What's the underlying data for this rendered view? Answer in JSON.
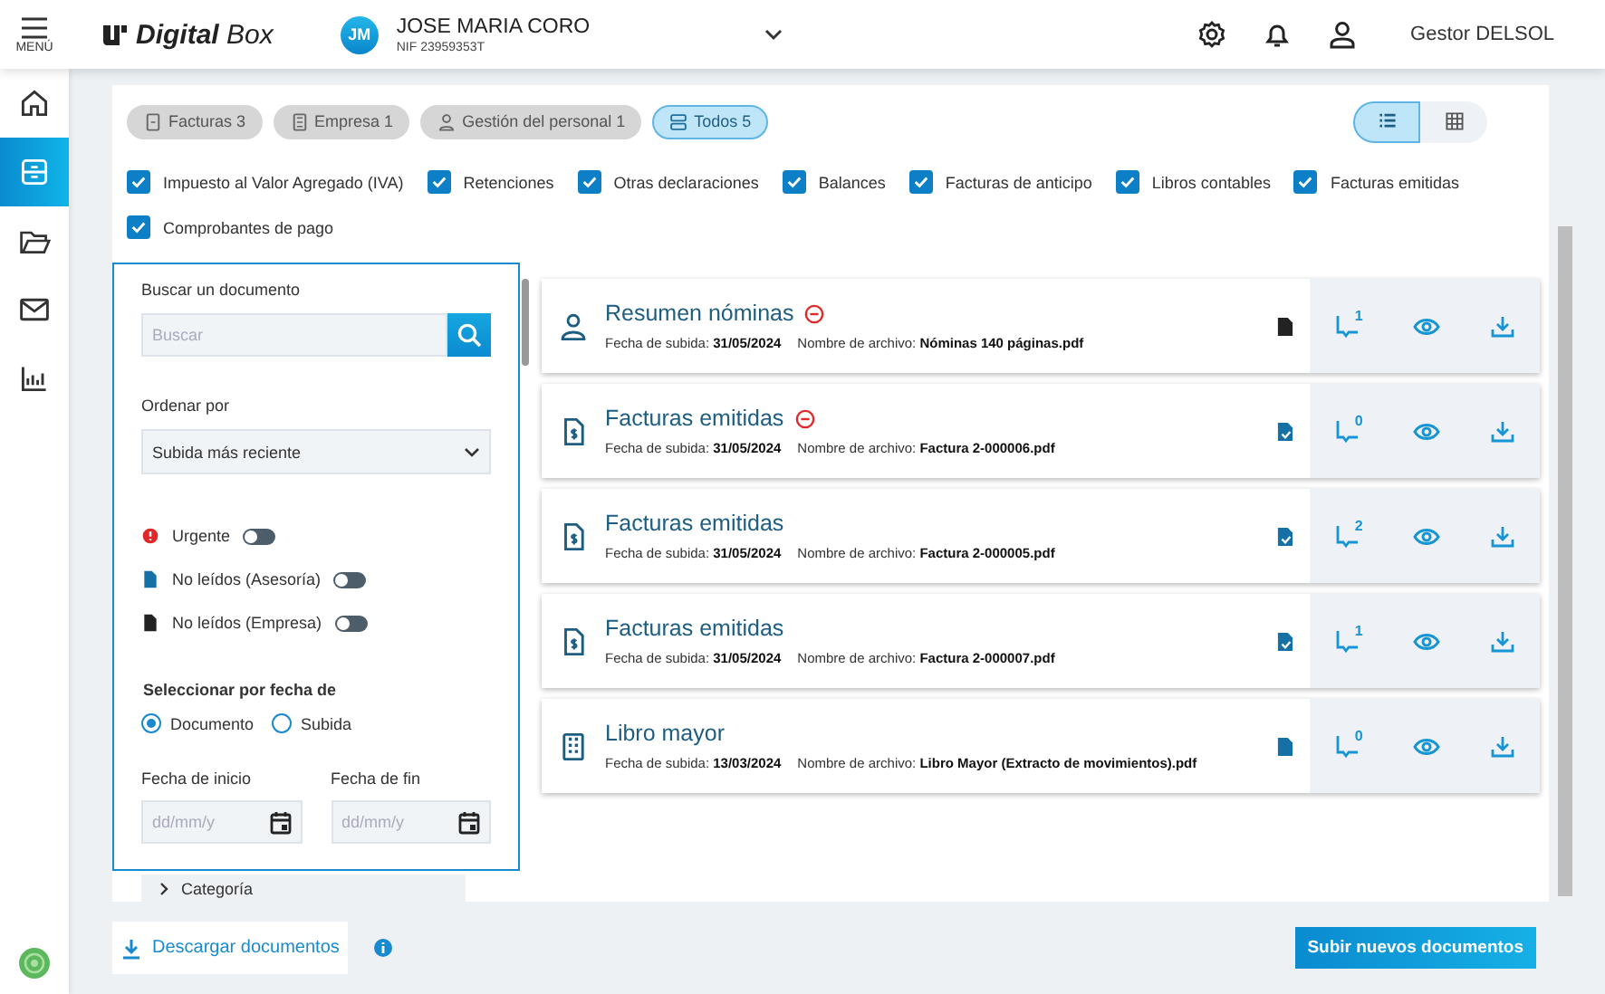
{
  "header": {
    "menu_label": "MENÚ",
    "logo": "**Digital** Box",
    "user": {
      "initials": "JM",
      "name": "JOSE MARIA CORO",
      "nif": "NIF 23959353T"
    },
    "account": "Gestor DELSOL"
  },
  "nav": [
    {
      "kind": "home",
      "selected": false
    },
    {
      "kind": "archive",
      "selected": true
    },
    {
      "kind": "folder",
      "selected": false
    },
    {
      "kind": "mail",
      "selected": false
    },
    {
      "kind": "chart",
      "selected": false
    }
  ],
  "chips": [
    {
      "kind": "invoice",
      "label": "Facturas 3",
      "selected": false
    },
    {
      "kind": "company",
      "label": "Empresa 1",
      "selected": false
    },
    {
      "kind": "person",
      "label": "Gestión del personal 1",
      "selected": false
    },
    {
      "kind": "all",
      "label": "Todos 5",
      "selected": true
    }
  ],
  "view_modes": [
    {
      "kind": "list",
      "selected": true
    },
    {
      "kind": "grid",
      "selected": false
    }
  ],
  "categories": [
    {
      "label": "Impuesto al Valor Agregado (IVA)",
      "checked": true
    },
    {
      "label": "Retenciones",
      "checked": true
    },
    {
      "label": "Otras declaraciones",
      "checked": true
    },
    {
      "label": "Balances",
      "checked": true
    },
    {
      "label": "Facturas de anticipo",
      "checked": true
    },
    {
      "label": "Libros contables",
      "checked": true
    },
    {
      "label": "Facturas emitidas",
      "checked": true
    },
    {
      "label": "Comprobantes de pago",
      "checked": true
    }
  ],
  "filters": {
    "search_label": "Buscar un documento",
    "search_placeholder": "Buscar",
    "sort_label": "Ordenar por",
    "sort_value": "Subida más reciente",
    "toggles": [
      {
        "kind": "urgent",
        "label": "Urgente",
        "on": false
      },
      {
        "kind": "advisor",
        "label": "No leídos (Asesoría)",
        "on": false
      },
      {
        "kind": "company",
        "label": "No leídos (Empresa)",
        "on": false
      }
    ],
    "date_label": "Seleccionar por fecha de",
    "radios": [
      {
        "label": "Documento",
        "selected": true
      },
      {
        "label": "Subida",
        "selected": false
      }
    ],
    "start_label": "Fecha de inicio",
    "end_label": "Fecha de fin",
    "start_placeholder": "dd/mm/y",
    "end_placeholder": "dd/mm/y",
    "category_section": "Categoría"
  },
  "documents": [
    {
      "kind": "person",
      "title": "Resumen nóminas",
      "urgent": true,
      "color": "#222222",
      "checked": false,
      "comments": "1",
      "upload": "Fecha de subida: **31/05/2024**",
      "file": "Nombre de archivo: **Nóminas 140 páginas.pdf**"
    },
    {
      "kind": "invoice",
      "title": "Facturas emitidas",
      "urgent": true,
      "color": "#1570a6",
      "checked": true,
      "comments": "0",
      "upload": "Fecha de subida: **31/05/2024**",
      "file": "Nombre de archivo: **Factura 2-000006.pdf**"
    },
    {
      "kind": "invoice",
      "title": "Facturas emitidas",
      "urgent": false,
      "color": "#1570a6",
      "checked": true,
      "comments": "2",
      "upload": "Fecha de subida: **31/05/2024**",
      "file": "Nombre de archivo: **Factura 2-000005.pdf**"
    },
    {
      "kind": "invoice",
      "title": "Facturas emitidas",
      "urgent": false,
      "color": "#1570a6",
      "checked": true,
      "comments": "1",
      "upload": "Fecha de subida: **31/05/2024**",
      "file": "Nombre de archivo: **Factura 2-000007.pdf**"
    },
    {
      "kind": "company",
      "title": "Libro mayor",
      "urgent": false,
      "color": "#1570a6",
      "checked": false,
      "comments": "0",
      "upload": "Fecha de subida: **13/03/2024**",
      "file": "Nombre de archivo: **Libro Mayor (Extracto de movimientos).pdf**"
    }
  ],
  "footer": {
    "download": "Descargar documentos",
    "upload": "Subir nuevos documentos"
  }
}
